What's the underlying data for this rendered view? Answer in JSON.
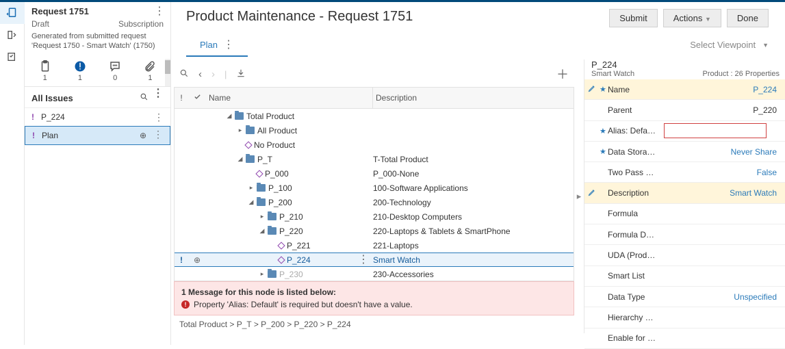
{
  "left_rail": {
    "items": [
      "clipboard-back-icon",
      "panel-icon",
      "checklist-icon"
    ]
  },
  "left_panel": {
    "title": "Request 1751",
    "status": "Draft",
    "type": "Subscription",
    "description": "Generated from submitted request 'Request 1750 - Smart Watch' (1750)",
    "tabs": [
      {
        "icon": "clipboard-icon",
        "count": "1"
      },
      {
        "icon": "alert-icon",
        "count": "1"
      },
      {
        "icon": "comment-icon",
        "count": "0"
      },
      {
        "icon": "attachment-icon",
        "count": "1"
      }
    ],
    "issues_header": "All Issues",
    "issues": [
      {
        "marker": "!",
        "label": "P_224"
      },
      {
        "marker": "!",
        "label": "Plan"
      }
    ]
  },
  "main": {
    "title": "Product Maintenance - Request 1751",
    "buttons": {
      "submit": "Submit",
      "actions": "Actions",
      "done": "Done"
    },
    "tab": "Plan",
    "viewpoint_label": "Select Viewpoint",
    "table": {
      "col_name": "Name",
      "col_desc": "Description",
      "rows": [
        {
          "depth": 2,
          "expand": "▲",
          "type": "folder",
          "name": "Total Product",
          "desc": ""
        },
        {
          "depth": 3,
          "expand": "▶",
          "type": "folder",
          "name": "All Product",
          "desc": ""
        },
        {
          "depth": 3,
          "expand": "",
          "type": "diamond",
          "name": "No Product",
          "desc": ""
        },
        {
          "depth": 3,
          "expand": "▲",
          "type": "folder",
          "name": "P_T",
          "desc": "T-Total Product"
        },
        {
          "depth": 4,
          "expand": "",
          "type": "diamond",
          "name": "P_000",
          "desc": "P_000-None"
        },
        {
          "depth": 4,
          "expand": "▶",
          "type": "folder",
          "name": "P_100",
          "desc": "100-Software Applications"
        },
        {
          "depth": 4,
          "expand": "▲",
          "type": "folder",
          "name": "P_200",
          "desc": "200-Technology"
        },
        {
          "depth": 5,
          "expand": "▶",
          "type": "folder",
          "name": "P_210",
          "desc": "210-Desktop Computers"
        },
        {
          "depth": 5,
          "expand": "▲",
          "type": "folder",
          "name": "P_220",
          "desc": "220-Laptops & Tablets & SmartPhone"
        },
        {
          "depth": 6,
          "expand": "",
          "type": "diamond",
          "name": "P_221",
          "desc": "221-Laptops"
        },
        {
          "depth": 6,
          "expand": "",
          "type": "diamond",
          "name": "P_224",
          "desc": "Smart Watch",
          "selected": true,
          "bang": "!",
          "plus": true
        },
        {
          "depth": 5,
          "expand": "▶",
          "type": "folder",
          "name": "P_230",
          "desc": "230-Accessories",
          "faded": true
        }
      ]
    },
    "error": {
      "title": "1 Message for this node is listed below:",
      "msg": "Property 'Alias: Default' is required but doesn't have a value."
    },
    "breadcrumb": "Total Product  >  P_T  >  P_200  >  P_220  >  P_224"
  },
  "props": {
    "id": "P_224",
    "name": "Smart Watch",
    "count_label": "Product : 26 Properties",
    "rows": [
      {
        "edit": true,
        "star": true,
        "label": "Name",
        "value": "P_224",
        "link": true,
        "hl": true
      },
      {
        "edit": false,
        "star": false,
        "label": "Parent",
        "value": "P_220",
        "link": false
      },
      {
        "edit": false,
        "star": true,
        "label": "Alias: Defa…",
        "value": "",
        "input": true
      },
      {
        "edit": false,
        "star": true,
        "label": "Data Stora…",
        "value": "Never Share",
        "link": true
      },
      {
        "edit": false,
        "star": false,
        "label": "Two Pass …",
        "value": "False",
        "link": true
      },
      {
        "edit": true,
        "star": false,
        "label": "Description",
        "value": "Smart Watch",
        "link": true,
        "hl": true
      },
      {
        "edit": false,
        "star": false,
        "label": "Formula",
        "value": ""
      },
      {
        "edit": false,
        "star": false,
        "label": "Formula D…",
        "value": ""
      },
      {
        "edit": false,
        "star": false,
        "label": "UDA (Prod…",
        "value": ""
      },
      {
        "edit": false,
        "star": false,
        "label": "Smart List",
        "value": ""
      },
      {
        "edit": false,
        "star": false,
        "label": "Data Type",
        "value": "Unspecified",
        "link": true
      },
      {
        "edit": false,
        "star": false,
        "label": "Hierarchy …",
        "value": ""
      },
      {
        "edit": false,
        "star": false,
        "label": "Enable for …",
        "value": ""
      }
    ]
  }
}
